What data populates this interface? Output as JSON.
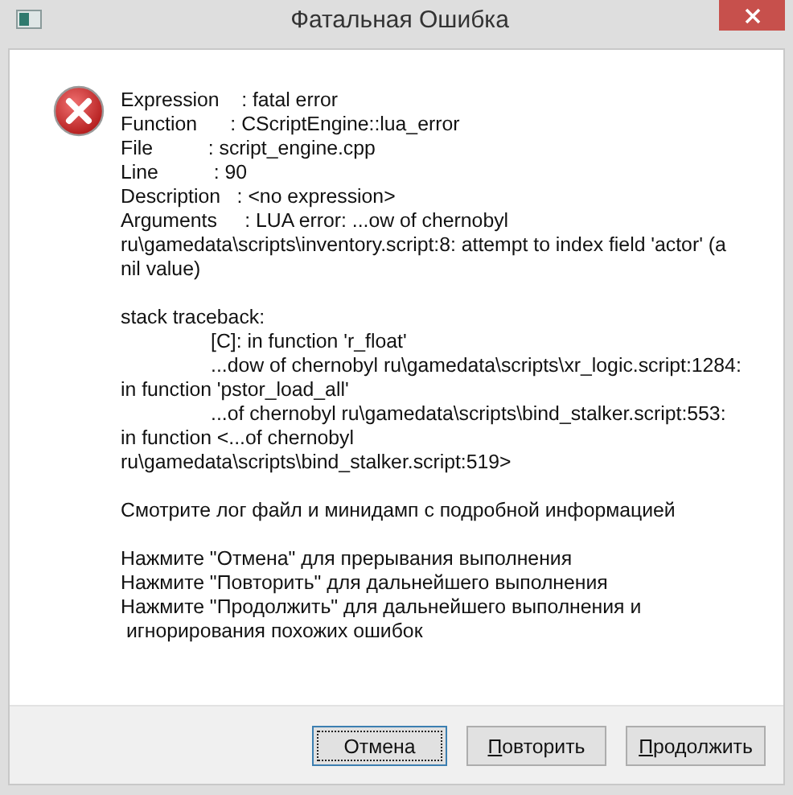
{
  "window": {
    "title": "Фатальная Ошибка"
  },
  "message": {
    "paragraphs": [
      [
        {
          "kind": "plain",
          "text": "Expression    : fatal error"
        },
        {
          "kind": "plain",
          "text": "Function      : CScriptEngine::lua_error"
        },
        {
          "kind": "plain",
          "text": "File          : script_engine.cpp"
        },
        {
          "kind": "plain",
          "text": "Line          : 90"
        },
        {
          "kind": "plain",
          "text": "Description   : <no expression>"
        },
        {
          "kind": "plain",
          "text": "Arguments     : LUA error: ...ow of chernobyl"
        },
        {
          "kind": "plain",
          "text": "ru\\gamedata\\scripts\\inventory.script:8: attempt to index field 'actor' (a"
        },
        {
          "kind": "plain",
          "text": "nil value)"
        }
      ],
      [
        {
          "kind": "plain",
          "text": "stack traceback:"
        },
        {
          "kind": "tab",
          "text": "[C]: in function 'r_float'"
        },
        {
          "kind": "tab",
          "text": "...dow of chernobyl ru\\gamedata\\scripts\\xr_logic.script:1284:"
        },
        {
          "kind": "plain",
          "text": "in function 'pstor_load_all'"
        },
        {
          "kind": "tab",
          "text": "...of chernobyl ru\\gamedata\\scripts\\bind_stalker.script:553:"
        },
        {
          "kind": "plain",
          "text": "in function <...of chernobyl"
        },
        {
          "kind": "plain",
          "text": "ru\\gamedata\\scripts\\bind_stalker.script:519>"
        }
      ],
      [
        {
          "kind": "plain",
          "text": "Смотрите лог файл и минидамп с подробной информацией"
        }
      ],
      [
        {
          "kind": "plain",
          "text": "Нажмите \"Отмена\" для прерывания выполнения"
        },
        {
          "kind": "plain",
          "text": "Нажмите \"Повторить\" для дальнейшего выполнения"
        },
        {
          "kind": "plain",
          "text": "Нажмите \"Продолжить\" для дальнейшего выполнения и"
        },
        {
          "kind": "plain",
          "text": " игнорирования похожих ошибок"
        }
      ]
    ]
  },
  "buttons": [
    {
      "label": "Отмена",
      "focused": true,
      "accelerator": false
    },
    {
      "label": "Повторить",
      "focused": false,
      "accelerator": true
    },
    {
      "label": "Продолжить",
      "focused": false,
      "accelerator": true
    }
  ]
}
